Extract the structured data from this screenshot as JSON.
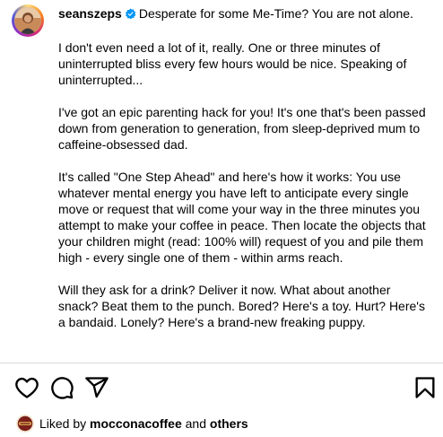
{
  "post": {
    "username": "seanszeps",
    "verified_icon": "verified-badge-icon",
    "caption_first": "Desperate for some Me-Time? You are not alone.",
    "paragraphs": [
      "I don't even need a lot of it, really. One or three minutes of uninterrupted bliss every few hours would be nice. Speaking of uninterrupted...",
      "I've got an epic parenting hack for you! It's one that's been passed down from generation to generation, from sleep-deprived mum to caffeine-obsessed dad.",
      "It's called \"One Step Ahead\" and here's how it works: You use whatever mental energy you have left to anticipate every single move or request that will come your way in the three minutes you attempt to make your coffee in peace. Then locate the objects that your children might (read: 100% will) request of you and pile them high - every single one of them - within arms reach.",
      "Will they ask for a drink? Deliver it now. What about another snack? Beat them to the punch. Bored? Here's a toy. Hurt? Here's a bandaid. Lonely? Here's a brand-new freaking puppy."
    ]
  },
  "actions": {
    "icons": [
      "heart-icon",
      "comment-icon",
      "share-icon",
      "bookmark-icon"
    ]
  },
  "likes": {
    "prefix": "Liked by",
    "first_user": "mocconacoffee",
    "connector": "and",
    "others": "others"
  },
  "colors": {
    "verified_blue": "#0095f6",
    "divider": "#dbdbdb"
  }
}
